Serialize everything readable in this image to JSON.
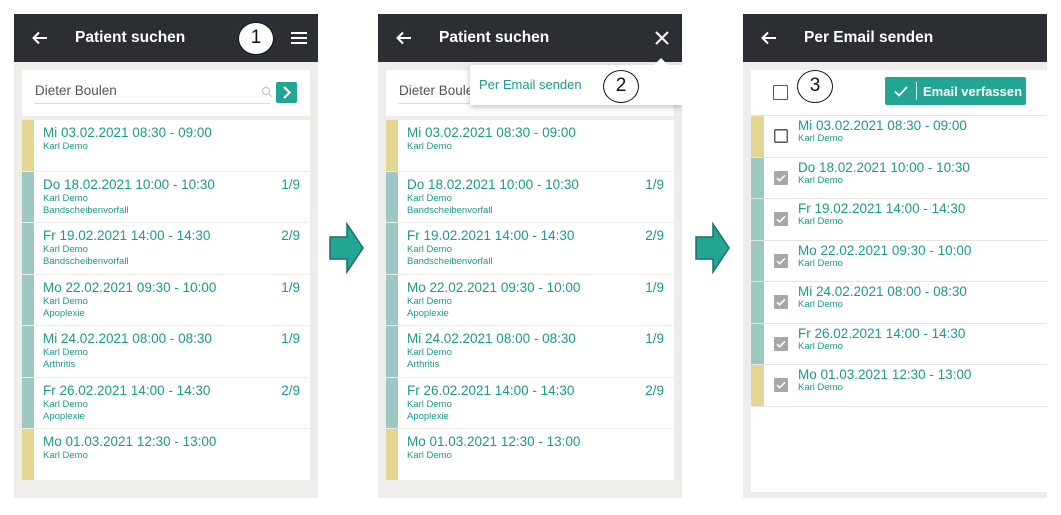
{
  "colors": {
    "topbar": "#2b2f33",
    "accent": "#23a594",
    "text_teal": "#1a9a8c",
    "bar_yellow": "#e3d693",
    "bar_teal": "#9cc7c3",
    "background": "#efedea"
  },
  "panels": [
    {
      "title": "Patient suchen",
      "right_icon": "hamburger-menu-icon",
      "search": {
        "value": "Dieter Boulen"
      },
      "callout": "1"
    },
    {
      "title": "Patient suchen",
      "right_icon": "close-icon",
      "search": {
        "value": "Dieter Boule"
      },
      "menu_item": "Per Email senden",
      "callout": "2"
    },
    {
      "title": "Per Email senden",
      "button_label": "Email verfassen",
      "callout": "3"
    }
  ],
  "appointments": [
    {
      "datetime": "Mi 03.02.2021 08:30 - 09:00",
      "doctor": "Karl Demo",
      "diagnosis": "",
      "count": "",
      "bar": "yellow"
    },
    {
      "datetime": "Do 18.02.2021 10:00 - 10:30",
      "doctor": "Karl Demo",
      "diagnosis": "Bandscheibenvorfall",
      "count": "1/9",
      "bar": "teal"
    },
    {
      "datetime": "Fr 19.02.2021 14:00 - 14:30",
      "doctor": "Karl Demo",
      "diagnosis": "Bandscheibenvorfall",
      "count": "2/9",
      "bar": "teal"
    },
    {
      "datetime": "Mo 22.02.2021 09:30 - 10:00",
      "doctor": "Karl Demo",
      "diagnosis": "Apoplexie",
      "count": "1/9",
      "bar": "teal"
    },
    {
      "datetime": "Mi 24.02.2021 08:00 - 08:30",
      "doctor": "Karl Demo",
      "diagnosis": "Arthritis",
      "count": "1/9",
      "bar": "teal"
    },
    {
      "datetime": "Fr 26.02.2021 14:00 - 14:30",
      "doctor": "Karl Demo",
      "diagnosis": "Apoplexie",
      "count": "2/9",
      "bar": "teal"
    },
    {
      "datetime": "Mo 01.03.2021 12:30 - 13:00",
      "doctor": "Karl Demo",
      "diagnosis": "",
      "count": "",
      "bar": "yellow"
    }
  ],
  "email_list": [
    {
      "datetime": "Mi 03.02.2021 08:30 - 09:00",
      "doctor": "Karl Demo",
      "checked": false,
      "bar": "yellow"
    },
    {
      "datetime": "Do 18.02.2021 10:00 - 10:30",
      "doctor": "Karl Demo",
      "checked": true,
      "bar": "teal"
    },
    {
      "datetime": "Fr 19.02.2021 14:00 - 14:30",
      "doctor": "Karl Demo",
      "checked": true,
      "bar": "teal"
    },
    {
      "datetime": "Mo 22.02.2021 09:30 - 10:00",
      "doctor": "Karl Demo",
      "checked": true,
      "bar": "teal"
    },
    {
      "datetime": "Mi 24.02.2021 08:00 - 08:30",
      "doctor": "Karl Demo",
      "checked": true,
      "bar": "teal"
    },
    {
      "datetime": "Fr 26.02.2021 14:00 - 14:30",
      "doctor": "Karl Demo",
      "checked": true,
      "bar": "teal"
    },
    {
      "datetime": "Mo 01.03.2021 12:30 - 13:00",
      "doctor": "Karl Demo",
      "checked": true,
      "bar": "yellow"
    }
  ]
}
